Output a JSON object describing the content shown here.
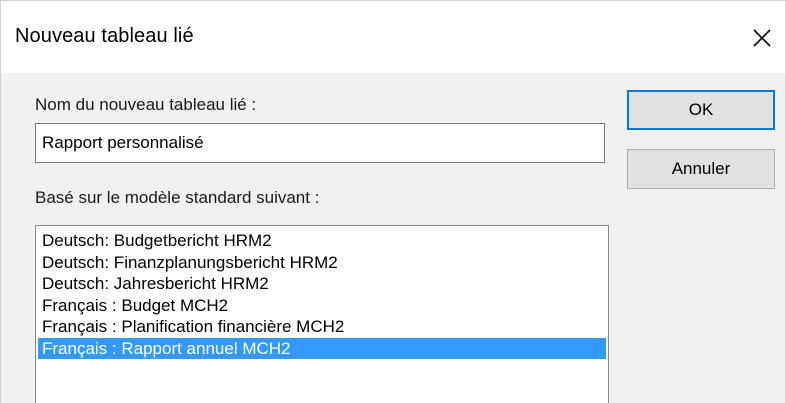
{
  "dialog": {
    "title": "Nouveau tableau lié",
    "close_icon": "close-icon"
  },
  "form": {
    "name_label": "Nom du nouveau tableau lié :",
    "name_value": "Rapport personnalisé",
    "template_label": "Basé sur le modèle standard suivant :",
    "templates": [
      "Deutsch: Budgetbericht HRM2",
      "Deutsch: Finanzplanungsbericht HRM2",
      "Deutsch: Jahresbericht HRM2",
      "Français : Budget MCH2",
      "Français : Planification financière MCH2",
      "Français : Rapport annuel MCH2"
    ],
    "selected_template_index": 5
  },
  "buttons": {
    "ok_label": "OK",
    "cancel_label": "Annuler"
  },
  "colors": {
    "selection": "#3399ff",
    "default_button_border": "#0078d7",
    "client_background": "#f0f0f0"
  }
}
